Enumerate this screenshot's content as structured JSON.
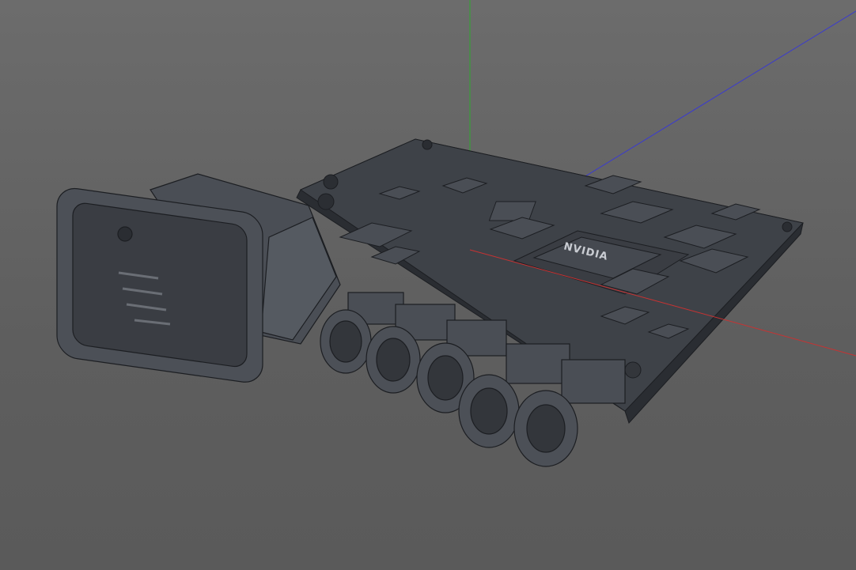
{
  "viewport": {
    "background": "#646464",
    "axes": {
      "x_color": "#c83232",
      "y_color": "#2fa82f",
      "z_color": "#3a3ad0"
    },
    "model": {
      "board_color": "#3e4248",
      "edge_color": "#1c1e22",
      "chip_logo": "NVIDIA",
      "round_connectors": 5
    }
  }
}
